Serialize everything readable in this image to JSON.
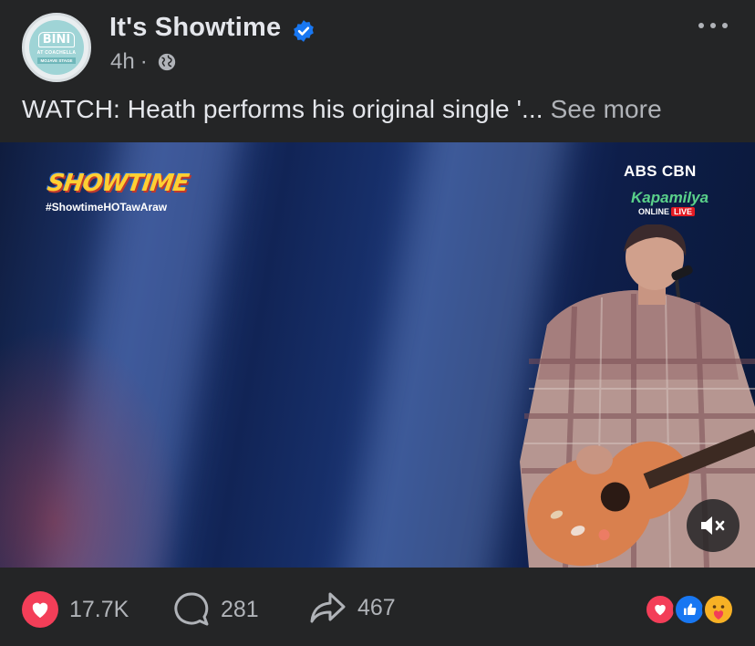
{
  "post": {
    "page_name": "It's Showtime",
    "time": "4h",
    "separator": "·",
    "caption": "WATCH: Heath performs his original single '...",
    "see_more": "See more",
    "avatar": {
      "logo_text": "BINI",
      "line1": "AT COACHELLA",
      "line2": "MOJAVE STAGE"
    }
  },
  "video": {
    "show_logo": "SHOWTIME",
    "hashtag": "#ShowtimeHOTawAraw",
    "network_logo": "ABS CBN",
    "channel": "Kapamilya",
    "online_label": "ONLINE",
    "live_label": "LIVE",
    "mute_icon": "speaker-muted-icon"
  },
  "engagement": {
    "reactions_count": "17.7K",
    "comments_count": "281",
    "shares_count": "467",
    "reaction_types": [
      "love",
      "like",
      "care"
    ]
  },
  "colors": {
    "background": "#242526",
    "text_primary": "#e4e6eb",
    "text_secondary": "#b0b3b8",
    "verified_blue": "#1877f2",
    "love_red": "#f33e58",
    "care_yellow": "#f7b125"
  }
}
